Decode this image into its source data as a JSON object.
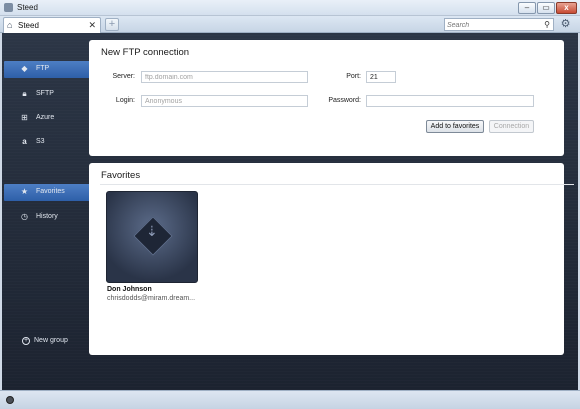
{
  "window": {
    "title": "Steed",
    "minimize": "–",
    "maximize": "▭",
    "close": "x"
  },
  "tabs": [
    {
      "label": "Steed",
      "close": "✕"
    }
  ],
  "search": {
    "placeholder": "Search"
  },
  "sidebar": {
    "items": [
      {
        "label": "FTP",
        "icon": "diamond-icon",
        "active": true
      },
      {
        "label": "SFTP",
        "icon": "lock-icon"
      },
      {
        "label": "Azure",
        "icon": "windows-logo-icon"
      },
      {
        "label": "S3",
        "icon": "amazon-logo-icon"
      },
      {
        "label": "Favorites",
        "icon": "star-icon",
        "active": true
      },
      {
        "label": "History",
        "icon": "clock-icon"
      }
    ],
    "new_group": "New group"
  },
  "connection": {
    "title": "New FTP connection",
    "server_label": "Server:",
    "server_placeholder": "ftp.domain.com",
    "port_label": "Port:",
    "port_value": "21",
    "login_label": "Login:",
    "login_placeholder": "Anonymous",
    "password_label": "Password:",
    "add_favorites": "Add to favorites",
    "connect": "Connection"
  },
  "favorites": {
    "title": "Favorites",
    "items": [
      {
        "name": "Don Johnson",
        "host": "chrisdodds@miram.dream..."
      }
    ]
  },
  "colors": {
    "accent": "#3a6bb3",
    "background": "#232b39"
  }
}
